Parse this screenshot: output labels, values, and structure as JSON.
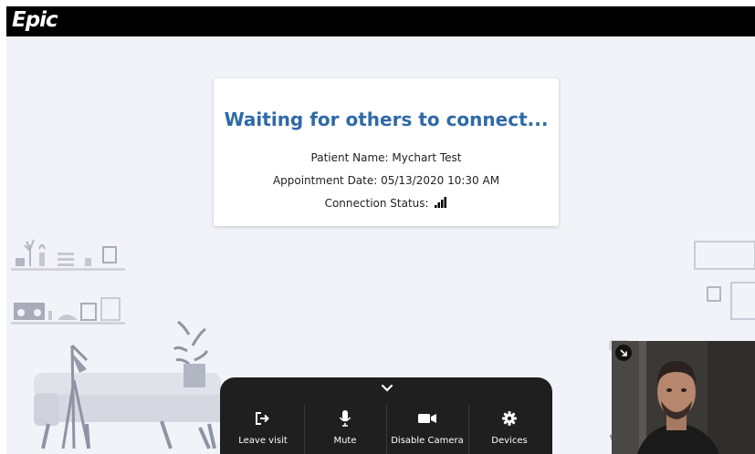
{
  "app": {
    "logo_text": "Epic"
  },
  "waiting_card": {
    "title": "Waiting for others to connect...",
    "patient_name": "Patient Name: Mychart Test",
    "appointment_date": "Appointment Date: 05/13/2020 10:30 AM",
    "connection_status_label": "Connection Status:",
    "connection_signal_bars": 4
  },
  "controls": {
    "collapse_icon": "chevron-down-icon",
    "buttons": [
      {
        "label": "Leave visit",
        "icon": "exit-icon"
      },
      {
        "label": "Mute",
        "icon": "microphone-icon"
      },
      {
        "label": "Disable Camera",
        "icon": "camera-icon"
      },
      {
        "label": "Devices",
        "icon": "gear-icon"
      }
    ]
  },
  "self_view": {
    "expand_icon": "expand-arrow-icon"
  },
  "colors": {
    "topbar": "#000000",
    "background": "#f1f3f9",
    "title_blue": "#2f6aa7",
    "controls_bg": "#1f1f1f",
    "decor_gray": "#b9bcc9"
  }
}
